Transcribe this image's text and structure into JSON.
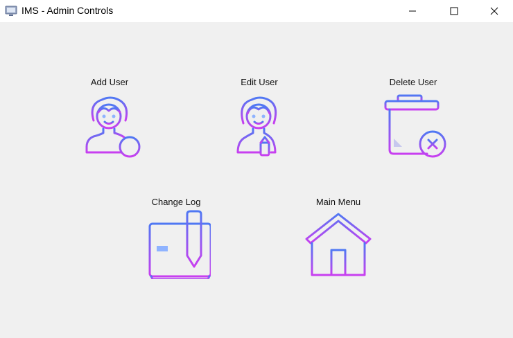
{
  "window": {
    "title": "IMS - Admin Controls",
    "icon": "monitor-icon"
  },
  "controls": {
    "add_user": {
      "label": "Add User",
      "icon": "add-user-icon"
    },
    "edit_user": {
      "label": "Edit User",
      "icon": "edit-user-icon"
    },
    "delete_user": {
      "label": "Delete User",
      "icon": "trash-icon"
    },
    "change_log": {
      "label": "Change Log",
      "icon": "log-document-icon"
    },
    "main_menu": {
      "label": "Main Menu",
      "icon": "home-icon"
    }
  },
  "colors": {
    "gradient_start": "#4f78f3",
    "gradient_end": "#c93ff0",
    "accent_light": "#8fb3ff"
  }
}
